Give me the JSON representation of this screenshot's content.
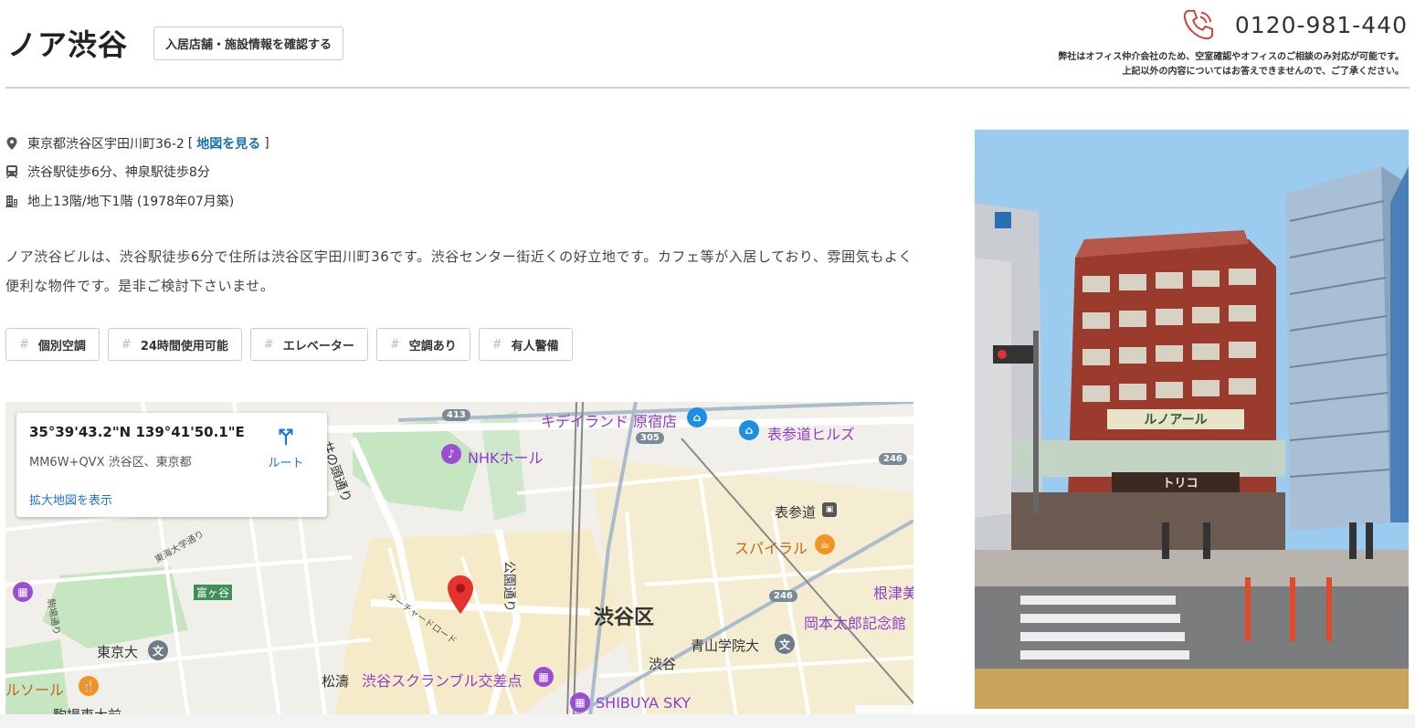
{
  "header": {
    "title": "ノア渋谷",
    "store_button": "入居店舗・施設情報を確認する",
    "phone": "0120-981-440",
    "note_line1": "弊社はオフィス仲介会社のため、空室確認やオフィスのご相談のみ対応が可能です。",
    "note_line2": "上記以外の内容についてはお答えできませんので、ご了承ください。"
  },
  "info": {
    "address_prefix": "東京都渋谷区宇田川町36-2",
    "bracket_open": "[",
    "map_link": "地図を見る",
    "bracket_close": "]",
    "access": "渋谷駅徒歩6分、神泉駅徒歩8分",
    "floors": "地上13階/地下1階 (1978年07月築)"
  },
  "description": "ノア渋谷ビルは、渋谷駅徒歩6分で住所は渋谷区宇田川町36です。渋谷センター街近くの好立地です。カフェ等が入居しており、雰囲気もよく便利な物件です。是非ご検討下さいませ。",
  "tags": [
    {
      "hash": "#",
      "label": "個別空調"
    },
    {
      "hash": "#",
      "label": "24時間使用可能"
    },
    {
      "hash": "#",
      "label": "エレベーター"
    },
    {
      "hash": "#",
      "label": "空調あり"
    },
    {
      "hash": "#",
      "label": "有人警備"
    }
  ],
  "map": {
    "card": {
      "coord": "35°39'43.2\"N 139°41'50.1\"E",
      "plus_code": "MM6W+QVX 渋谷区、東京都",
      "route": "ルート",
      "enlarge": "拡大地図を表示"
    },
    "labels": {
      "kiddyland": "キデイランド 原宿店",
      "omotesando_hills": "表参道ヒルズ",
      "nhk_hall": "NHKホール",
      "omotesando": "表参道",
      "spiral": "スパイラル",
      "nezu": "根津美",
      "okamoto": "岡本太郎記念館",
      "shibuya_ku": "渋谷区",
      "aoyama": "青山学院大",
      "shibuya": "渋谷",
      "scramble": "渋谷スクランブル交差点",
      "shibuya_sky": "SHIBUYA SKY",
      "matsunami": "松濤",
      "tokyo_univ": "東京大",
      "solar": "ルソール",
      "tomigaya": "富ヶ谷",
      "komaba": "駒場東大前",
      "inokashira": "井の頭通り",
      "koen_dori": "公園通り",
      "orchard": "オーチャードロード",
      "tokai": "東海大学通り",
      "park_st": "駒場通り",
      "route_413": "413",
      "route_305": "305",
      "route_246a": "246",
      "route_246b": "246"
    }
  },
  "photo_sign": "ルノアール",
  "photo_sign2": "トリコ",
  "colors": {
    "link": "#1a6fb3",
    "pin": "#e5322d",
    "phone_icon": "#d03a3a",
    "poi_purple": "#9a4fd1",
    "poi_blue": "#1a8fe3",
    "poi_orange": "#f29423"
  }
}
